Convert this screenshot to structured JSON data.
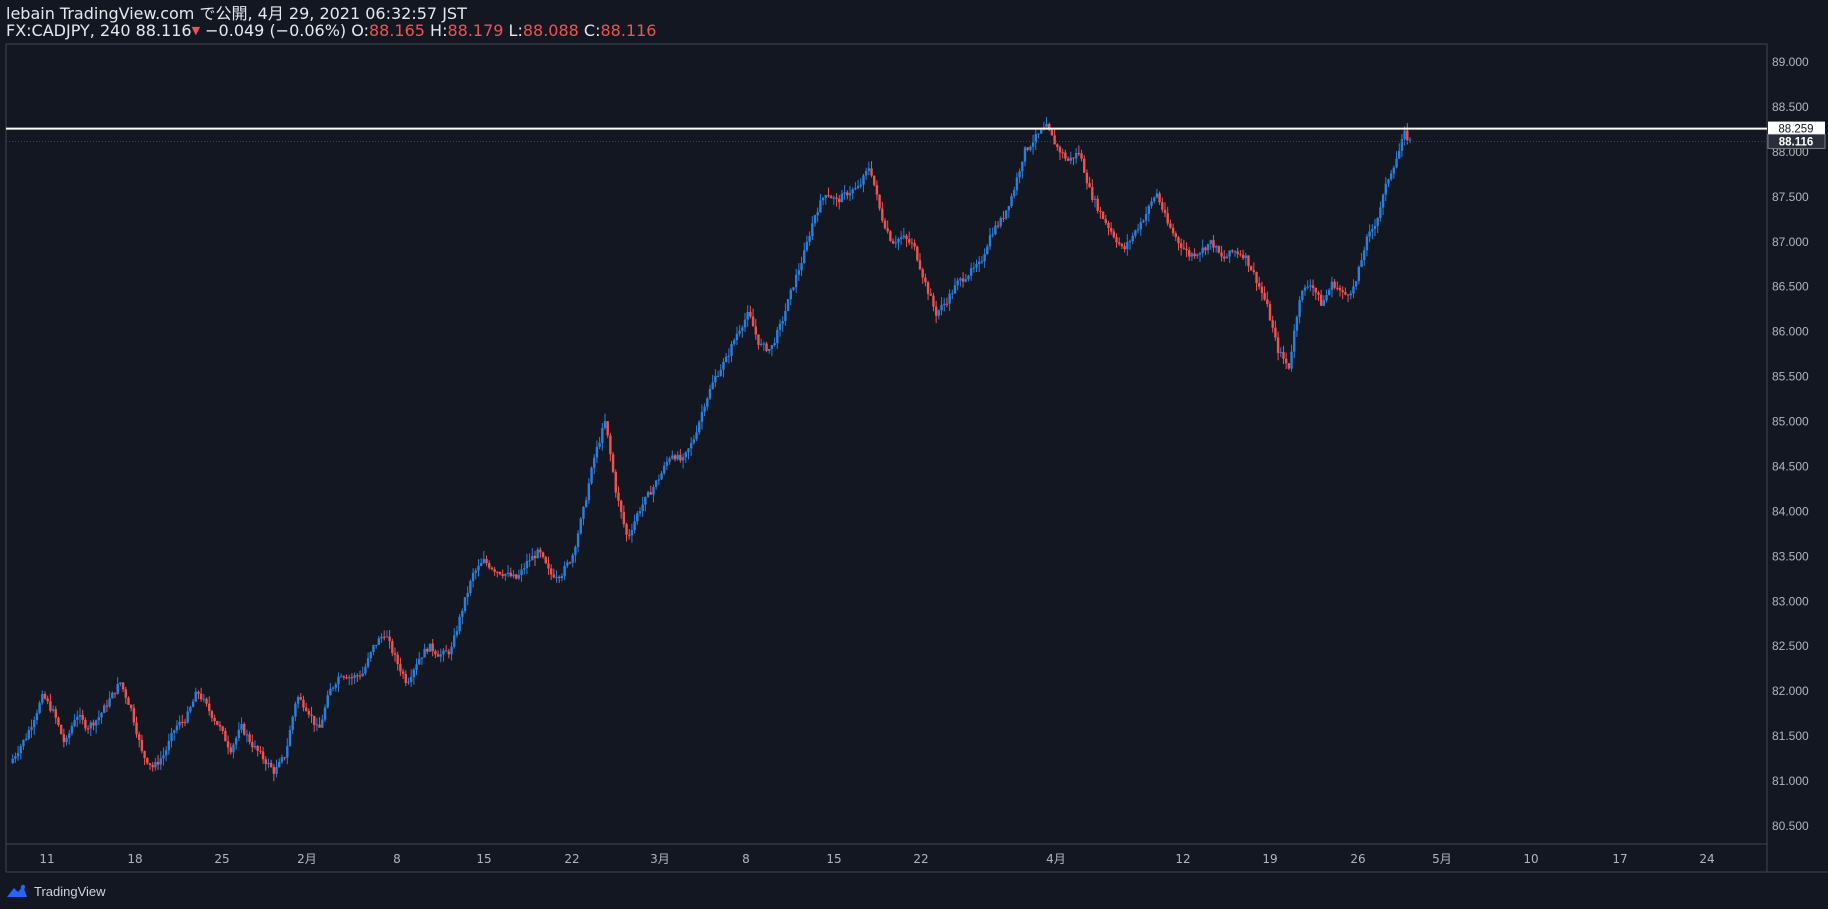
{
  "header": {
    "line1": "lebain TradingView.com で公開, 4月 29, 2021 06:32:57 JST",
    "symbol": "FX:CADJPY, 240",
    "last": "88.116",
    "change_arrow": "▼",
    "change": "−0.049 (−0.06%)",
    "o_label": "O:",
    "o": "88.165",
    "h_label": "H:",
    "h": "88.179",
    "l_label": "L:",
    "l": "88.088",
    "c_label": "C:",
    "c": "88.116"
  },
  "brand": {
    "name": "TradingView"
  },
  "colors": {
    "background": "#131722",
    "up": "#2a7fdd",
    "down": "#ef5350",
    "axis_text": "#b2b5be",
    "horizontal_line": "#ffffff"
  },
  "chart_data": {
    "type": "candlestick",
    "y_axis": {
      "range": [
        80.3,
        89.2
      ],
      "ticks": [
        "80.500",
        "81.000",
        "81.500",
        "82.000",
        "82.500",
        "83.000",
        "83.500",
        "84.000",
        "84.500",
        "85.000",
        "85.500",
        "86.000",
        "86.500",
        "87.000",
        "87.500",
        "88.000",
        "88.500",
        "89.000"
      ]
    },
    "x_axis": {
      "ticks": [
        "11",
        "18",
        "25",
        "2月",
        "8",
        "15",
        "22",
        "3月",
        "8",
        "15",
        "22",
        "4月",
        "12",
        "19",
        "26",
        "5月",
        "10",
        "17",
        "24"
      ]
    },
    "horizontal_line": {
      "value": 88.259,
      "label": "88.259"
    },
    "last_price": {
      "value": 88.116,
      "label": "88.116"
    },
    "path_points": [
      [
        0,
        81.2
      ],
      [
        3,
        81.5
      ],
      [
        6,
        81.95
      ],
      [
        8,
        81.75
      ],
      [
        10,
        81.4
      ],
      [
        12,
        81.75
      ],
      [
        14,
        81.6
      ],
      [
        16,
        81.7
      ],
      [
        18,
        81.9
      ],
      [
        20,
        82.1
      ],
      [
        22,
        81.8
      ],
      [
        24,
        81.3
      ],
      [
        26,
        81.15
      ],
      [
        28,
        81.3
      ],
      [
        30,
        81.6
      ],
      [
        32,
        81.7
      ],
      [
        34,
        82.0
      ],
      [
        36,
        81.8
      ],
      [
        38,
        81.6
      ],
      [
        40,
        81.35
      ],
      [
        42,
        81.6
      ],
      [
        44,
        81.4
      ],
      [
        46,
        81.25
      ],
      [
        48,
        81.1
      ],
      [
        50,
        81.3
      ],
      [
        52,
        81.95
      ],
      [
        54,
        81.8
      ],
      [
        56,
        81.55
      ],
      [
        58,
        82.0
      ],
      [
        60,
        82.2
      ],
      [
        62,
        82.15
      ],
      [
        64,
        82.2
      ],
      [
        66,
        82.5
      ],
      [
        68,
        82.65
      ],
      [
        70,
        82.35
      ],
      [
        72,
        82.1
      ],
      [
        74,
        82.35
      ],
      [
        76,
        82.5
      ],
      [
        78,
        82.4
      ],
      [
        80,
        82.45
      ],
      [
        82,
        82.9
      ],
      [
        84,
        83.3
      ],
      [
        86,
        83.45
      ],
      [
        88,
        83.35
      ],
      [
        90,
        83.3
      ],
      [
        92,
        83.25
      ],
      [
        94,
        83.45
      ],
      [
        96,
        83.55
      ],
      [
        98,
        83.3
      ],
      [
        100,
        83.3
      ],
      [
        102,
        83.5
      ],
      [
        104,
        84.0
      ],
      [
        106,
        84.6
      ],
      [
        108,
        85.0
      ],
      [
        110,
        84.2
      ],
      [
        112,
        83.7
      ],
      [
        114,
        84.0
      ],
      [
        116,
        84.2
      ],
      [
        118,
        84.4
      ],
      [
        120,
        84.65
      ],
      [
        122,
        84.55
      ],
      [
        124,
        84.8
      ],
      [
        126,
        85.2
      ],
      [
        128,
        85.5
      ],
      [
        130,
        85.7
      ],
      [
        132,
        86.0
      ],
      [
        134,
        86.2
      ],
      [
        136,
        85.85
      ],
      [
        138,
        85.8
      ],
      [
        140,
        86.1
      ],
      [
        142,
        86.5
      ],
      [
        144,
        86.85
      ],
      [
        146,
        87.3
      ],
      [
        148,
        87.55
      ],
      [
        150,
        87.45
      ],
      [
        152,
        87.55
      ],
      [
        154,
        87.6
      ],
      [
        156,
        87.85
      ],
      [
        158,
        87.3
      ],
      [
        160,
        87.0
      ],
      [
        162,
        87.05
      ],
      [
        164,
        86.95
      ],
      [
        166,
        86.55
      ],
      [
        168,
        86.2
      ],
      [
        170,
        86.35
      ],
      [
        172,
        86.55
      ],
      [
        174,
        86.65
      ],
      [
        176,
        86.75
      ],
      [
        178,
        87.1
      ],
      [
        180,
        87.25
      ],
      [
        182,
        87.55
      ],
      [
        184,
        88.0
      ],
      [
        186,
        88.15
      ],
      [
        188,
        88.28
      ],
      [
        190,
        88.05
      ],
      [
        192,
        87.9
      ],
      [
        194,
        88.0
      ],
      [
        196,
        87.55
      ],
      [
        198,
        87.3
      ],
      [
        200,
        87.1
      ],
      [
        202,
        86.9
      ],
      [
        204,
        87.1
      ],
      [
        206,
        87.3
      ],
      [
        208,
        87.55
      ],
      [
        210,
        87.2
      ],
      [
        212,
        87.0
      ],
      [
        214,
        86.85
      ],
      [
        216,
        86.9
      ],
      [
        218,
        87.0
      ],
      [
        220,
        86.8
      ],
      [
        222,
        86.9
      ],
      [
        224,
        86.85
      ],
      [
        226,
        86.6
      ],
      [
        228,
        86.3
      ],
      [
        230,
        85.8
      ],
      [
        232,
        85.6
      ],
      [
        234,
        86.4
      ],
      [
        236,
        86.55
      ],
      [
        238,
        86.3
      ],
      [
        240,
        86.55
      ],
      [
        242,
        86.4
      ],
      [
        244,
        86.5
      ],
      [
        246,
        87.0
      ],
      [
        248,
        87.25
      ],
      [
        250,
        87.7
      ],
      [
        252,
        88.0
      ],
      [
        253,
        88.2
      ],
      [
        254,
        88.116
      ]
    ]
  }
}
